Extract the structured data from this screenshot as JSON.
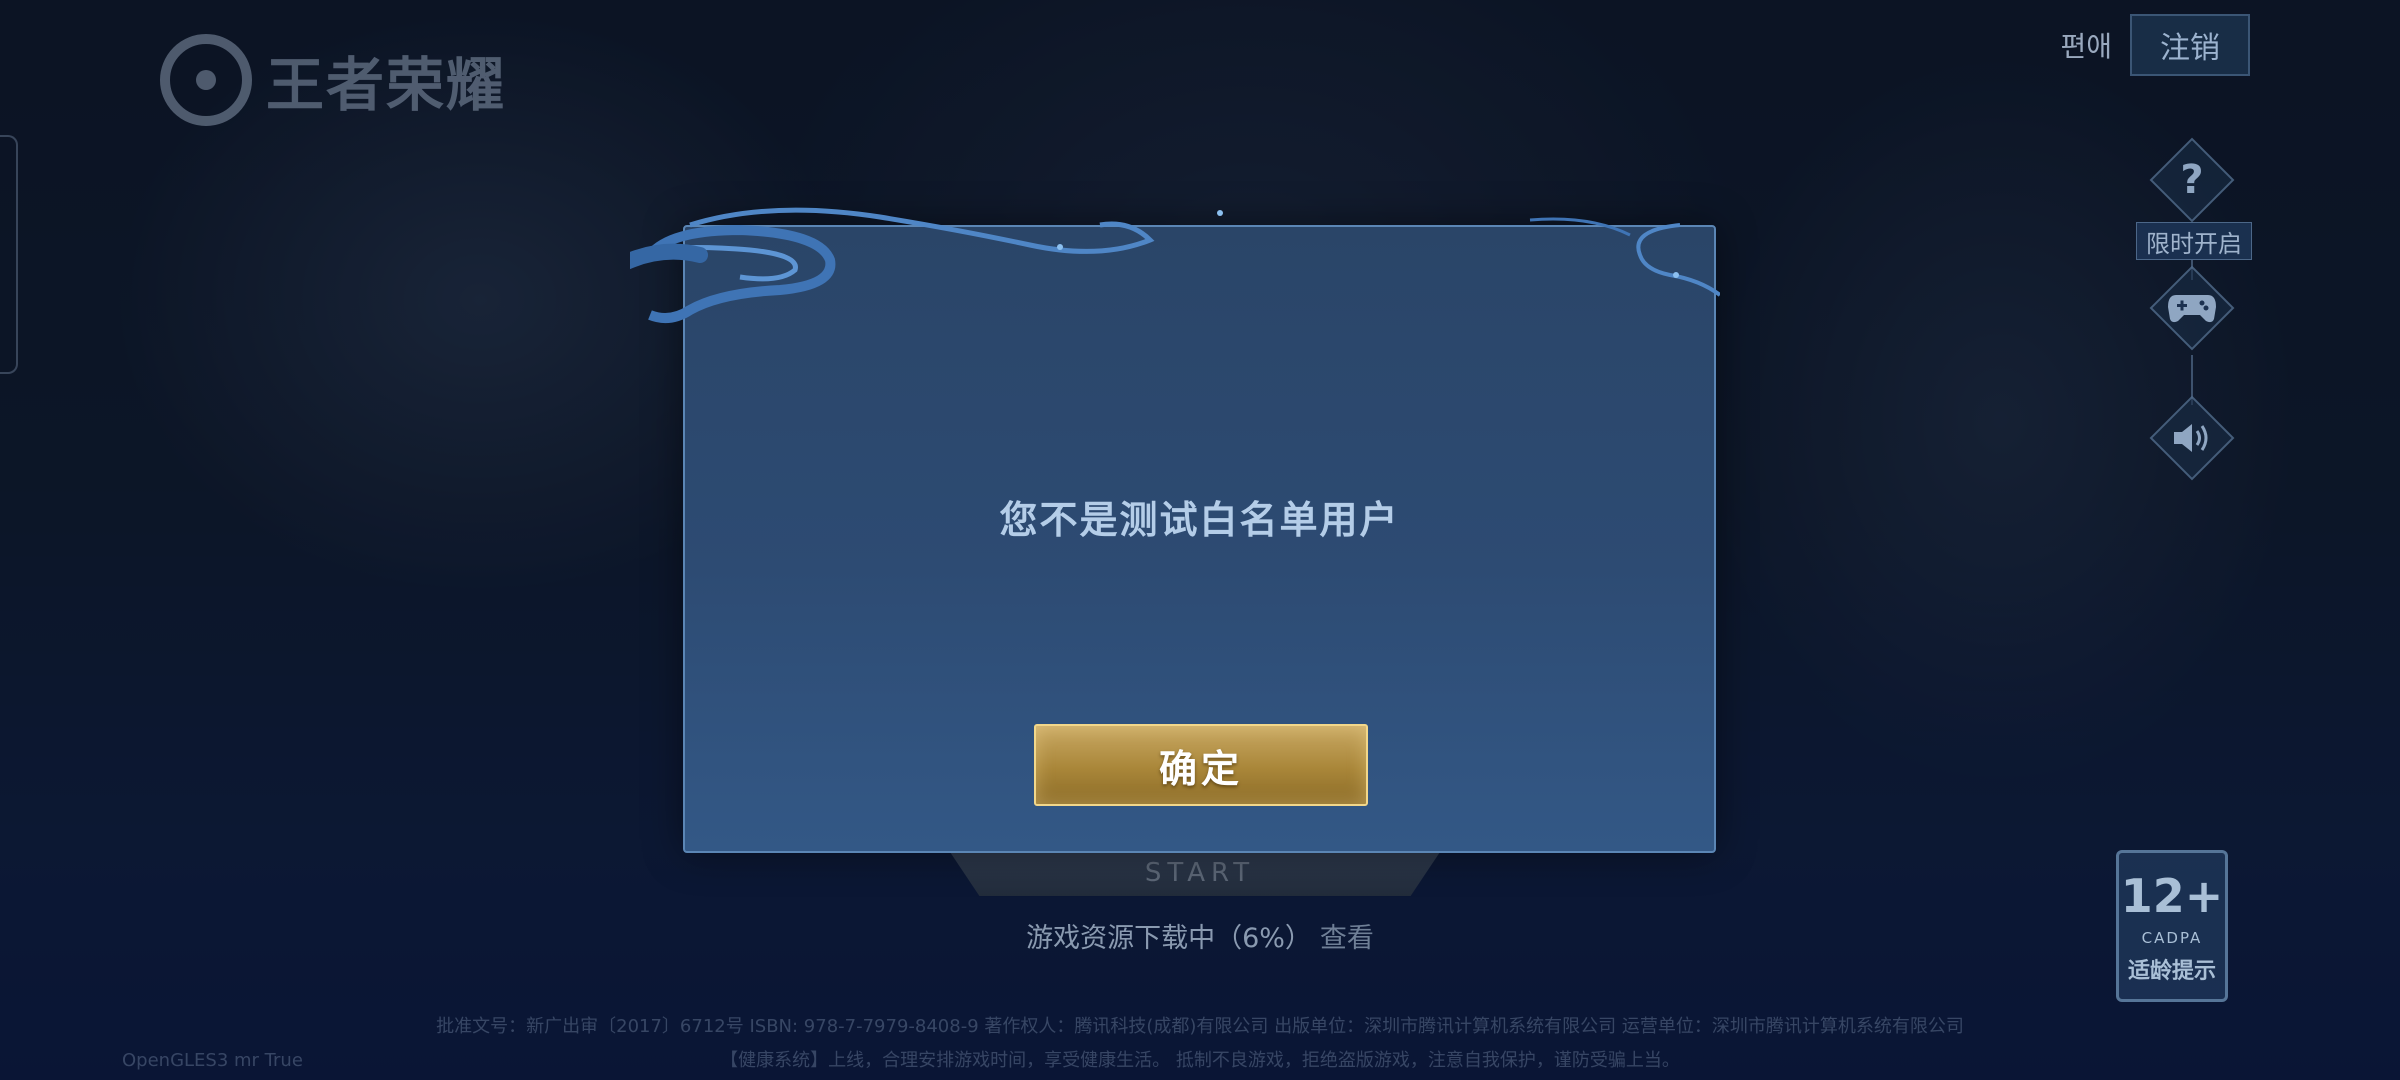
{
  "header": {
    "logo_text": "王者荣耀",
    "edit_label": "편애",
    "logout_label": "注销"
  },
  "side_rail": {
    "help_icon": "question-icon",
    "limited_label": "限时开启",
    "gamepad_icon": "gamepad-icon",
    "sound_icon": "speaker-icon"
  },
  "dialog": {
    "message": "您不是测试白名单用户",
    "confirm_label": "确定"
  },
  "start": {
    "label": "START"
  },
  "download": {
    "text": "游戏资源下载中（6%）",
    "progress_percent": 6,
    "view_label": "查看"
  },
  "age_rating": {
    "rating": "12+",
    "org": "CADPA",
    "tip": "适龄提示"
  },
  "footer": {
    "line1": "批准文号：新广出审〔2017〕6712号 ISBN: 978-7-7979-8408-9 著作权人：腾讯科技(成都)有限公司 出版单位：深圳市腾讯计算机系统有限公司 运营单位：深圳市腾讯计算机系统有限公司",
    "line2": "【健康系统】上线，合理安排游戏时间，享受健康生活。 抵制不良游戏，拒绝盗版游戏，注意自我保护，谨防受骗上当。",
    "left_text": "OpenGLES3 mr True"
  }
}
